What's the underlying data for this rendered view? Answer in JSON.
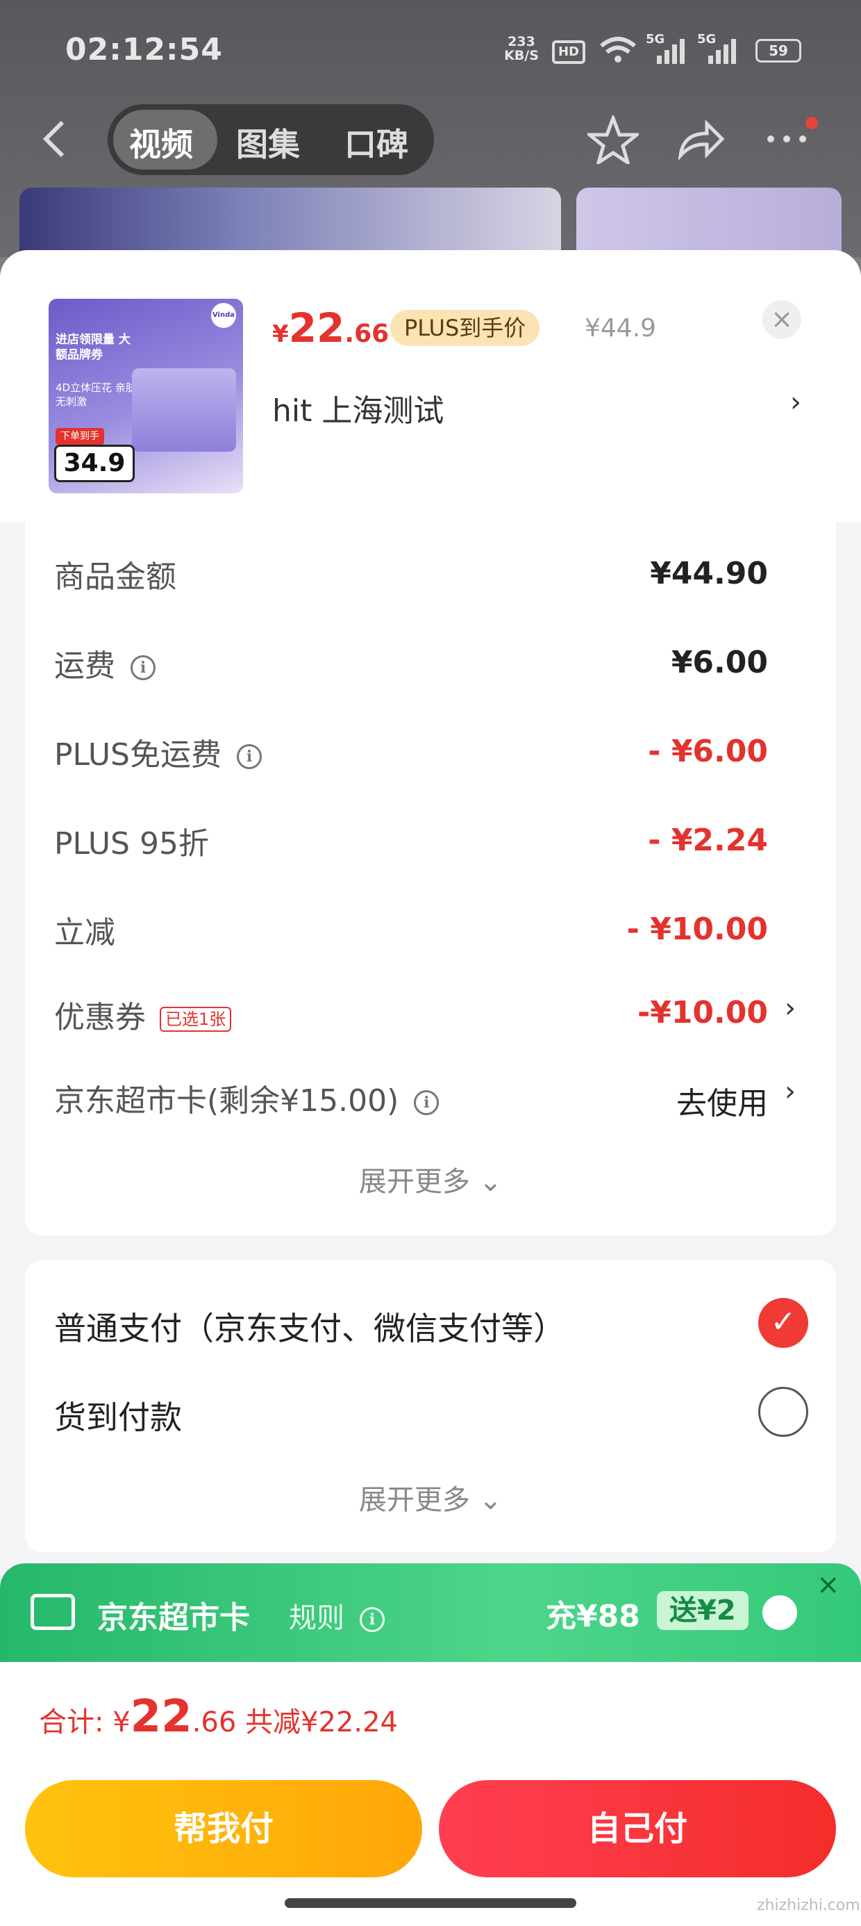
{
  "status_bar": {
    "time": "02:12:54",
    "net_speed_value": "233",
    "net_speed_unit": "KB/S",
    "hd": "HD",
    "signal1": "5G",
    "signal2": "5G",
    "battery": "59"
  },
  "nav": {
    "tabs": [
      {
        "label": "视频",
        "active": true
      },
      {
        "label": "图集"
      },
      {
        "label": "口碑"
      }
    ],
    "icons": [
      "back-icon",
      "star-icon",
      "share-icon",
      "more-icon"
    ]
  },
  "product": {
    "price_symbol": "¥",
    "price_int": "22",
    "price_dec": ".66",
    "plus_tag": "PLUS到手价",
    "original_price": "¥44.9",
    "shop": "hit 上海测试",
    "thumb_badge_label": "下单到手",
    "thumb_price": "34.9",
    "thumb_title": "进店领限量 大额品牌券",
    "thumb_sub": "4D立体压花 亲肤无刺激",
    "thumb_brand": "Vinda"
  },
  "costs": [
    {
      "label": "商品金额",
      "value": "¥44.90",
      "tone": "black"
    },
    {
      "label": "运费",
      "value": "¥6.00",
      "tone": "black",
      "info": true
    },
    {
      "label": "PLUS免运费",
      "value": "- ¥6.00",
      "tone": "red",
      "info": true
    },
    {
      "label": "PLUS 95折",
      "value": "- ¥2.24",
      "tone": "red"
    },
    {
      "label": "立减",
      "value": "- ¥10.00",
      "tone": "red"
    },
    {
      "label": "优惠券",
      "badge": "已选1张",
      "value": "-¥10.00",
      "tone": "red",
      "chevron": true
    },
    {
      "label": "京东超市卡(剩余¥15.00)",
      "value": "去使用",
      "tone": "black",
      "info": true,
      "chevron": true
    }
  ],
  "expand_more": "展开更多",
  "payment": {
    "options": [
      {
        "label": "普通支付（京东支付、微信支付等）",
        "selected": true
      },
      {
        "label": "货到付款",
        "selected": false
      }
    ],
    "expand_more": "展开更多"
  },
  "jd_card": {
    "title": "京东超市卡",
    "rule": "规则",
    "recharge": "充¥88",
    "gift": "送¥2"
  },
  "total": {
    "label": "合计: ¥",
    "int": "22",
    "dec": ".66",
    "saved": "共减¥22.24"
  },
  "buttons": {
    "help_pay": "帮我付",
    "self_pay": "自己付"
  },
  "watermark": "zhizhizhi.com",
  "colors": {
    "red": "#e4322d",
    "green": "#34c97a",
    "yellow": "#ffb70c"
  }
}
